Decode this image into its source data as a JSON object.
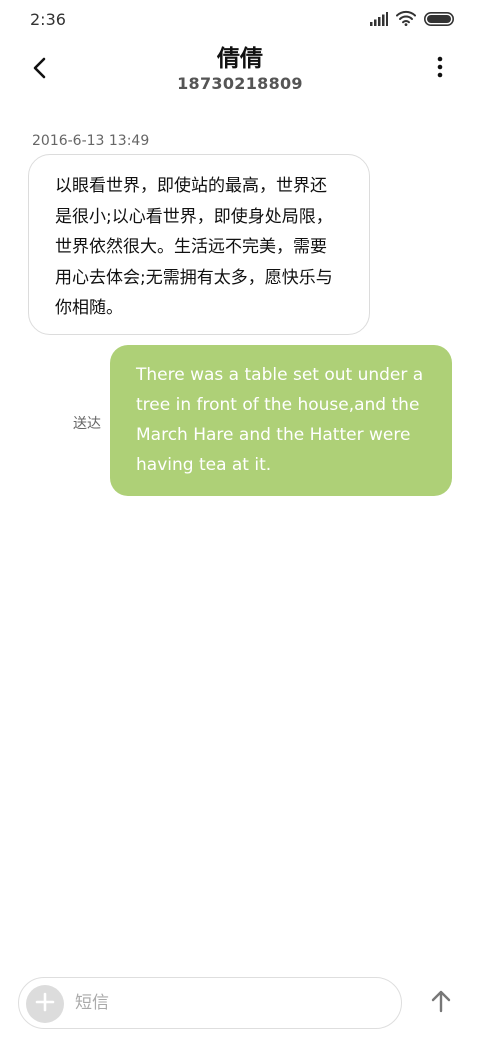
{
  "status_bar": {
    "time": "2:36",
    "icons": [
      "signal-icon",
      "wifi-icon",
      "battery-icon"
    ]
  },
  "header": {
    "contact_name": "倩倩",
    "contact_number": "18730218809",
    "back_icon": "back-arrow-icon",
    "more_icon": "more-vertical-icon"
  },
  "conversation": {
    "timestamp": "2016-6-13 13:49",
    "incoming_message": "以眼看世界，即使站的最高，世界还是很小;以心看世界，即使身处局限，世界依然很大。生活远不完美，需要用心去体会;无需拥有太多，愿快乐与你相随。",
    "outgoing_message": "There was a table set out under a tree in front of the house,and the March Hare and the Hatter were having tea at it.",
    "outgoing_status": "送达"
  },
  "composer": {
    "placeholder": "短信",
    "value": "",
    "add_icon": "plus-icon",
    "send_icon": "send-arrow-icon"
  },
  "colors": {
    "outgoing_bubble": "#aed077",
    "incoming_border": "#dcdcdc",
    "add_button": "#dcdcdc"
  }
}
